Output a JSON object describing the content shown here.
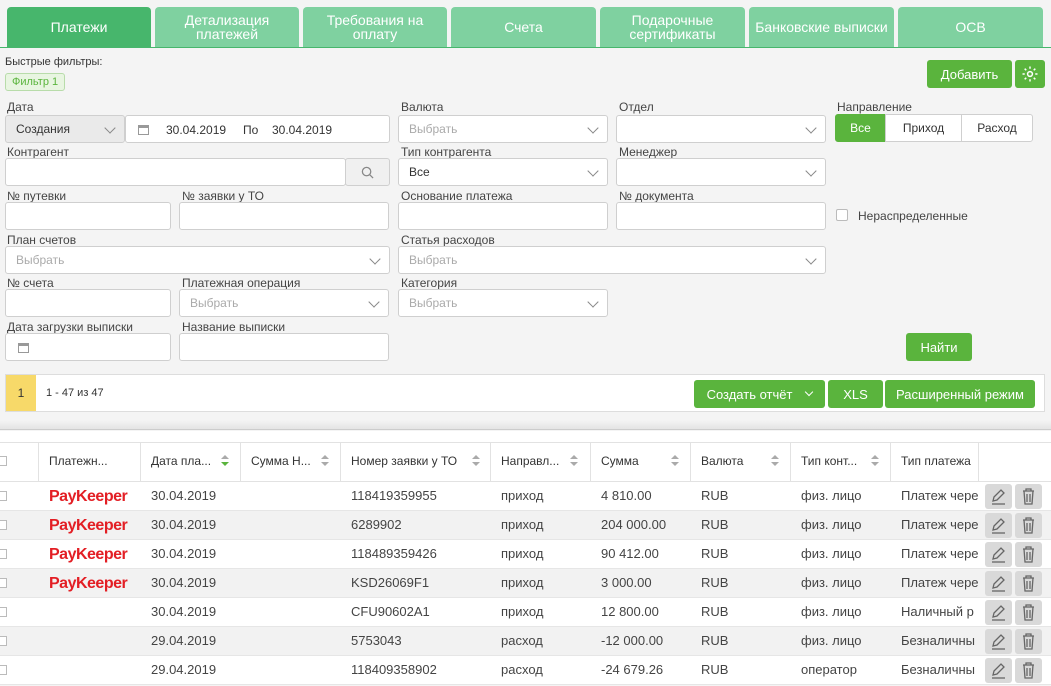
{
  "tabs": [
    {
      "label": "Платежи",
      "active": true
    },
    {
      "label": "Детализация платежей"
    },
    {
      "label": "Требования на оплату"
    },
    {
      "label": "Счета"
    },
    {
      "label": "Подарочные сертификаты"
    },
    {
      "label": "Банковские выписки"
    },
    {
      "label": "ОСВ"
    }
  ],
  "quick_filters": {
    "label": "Быстрые фильтры:",
    "chip": "Фильтр 1"
  },
  "add_button": "Добавить",
  "filters": {
    "date": {
      "label": "Дата",
      "type_value": "Создания",
      "from": "30.04.2019",
      "to_label": "По",
      "to": "30.04.2019"
    },
    "currency": {
      "label": "Валюта",
      "placeholder": "Выбрать"
    },
    "department": {
      "label": "Отдел",
      "value": ""
    },
    "direction": {
      "label": "Направление",
      "options": [
        "Все",
        "Приход",
        "Расход"
      ],
      "selected": "Все"
    },
    "counterparty": {
      "label": "Контрагент",
      "value": ""
    },
    "counterparty_type": {
      "label": "Тип контрагента",
      "value": "Все"
    },
    "manager": {
      "label": "Менеджер",
      "value": ""
    },
    "voucher_no": {
      "label": "№ путевки"
    },
    "to_request_no": {
      "label": "№ заявки у ТО"
    },
    "payment_basis": {
      "label": "Основание платежа"
    },
    "document_no": {
      "label": "№ документа"
    },
    "unallocated": {
      "label": "Нераспределенные",
      "checked": false
    },
    "chart_of_accounts": {
      "label": "План счетов",
      "placeholder": "Выбрать"
    },
    "expense_item": {
      "label": "Статья расходов",
      "placeholder": "Выбрать"
    },
    "account_no": {
      "label": "№ счета"
    },
    "payment_operation": {
      "label": "Платежная операция",
      "placeholder": "Выбрать"
    },
    "category": {
      "label": "Категория",
      "placeholder": "Выбрать"
    },
    "statement_upload_date": {
      "label": "Дата загрузки выписки"
    },
    "statement_name": {
      "label": "Название выписки"
    }
  },
  "find_button": "Найти",
  "pager": {
    "page": "1",
    "range": "1 - 47 из 47"
  },
  "toolbar": {
    "report": "Создать отчёт",
    "xls": "XLS",
    "advanced": "Расширенный режим"
  },
  "table": {
    "columns": [
      "Платежн...",
      "Дата пла...",
      "Сумма Н...",
      "Номер заявки у ТО",
      "Направл...",
      "Сумма",
      "Валюта",
      "Тип конт...",
      "Тип платежа"
    ],
    "rows": [
      {
        "system": "PayKeeper",
        "date": "30.04.2019",
        "sum_n": "",
        "request": "118419359955",
        "direction": "приход",
        "amount": "4 810.00",
        "currency": "RUB",
        "cp_type": "физ. лицо",
        "pay_type": "Платеж чере"
      },
      {
        "system": "PayKeeper",
        "date": "30.04.2019",
        "sum_n": "",
        "request": "6289902",
        "direction": "приход",
        "amount": "204 000.00",
        "currency": "RUB",
        "cp_type": "физ. лицо",
        "pay_type": "Платеж чере"
      },
      {
        "system": "PayKeeper",
        "date": "30.04.2019",
        "sum_n": "",
        "request": "118489359426",
        "direction": "приход",
        "amount": "90 412.00",
        "currency": "RUB",
        "cp_type": "физ. лицо",
        "pay_type": "Платеж чере"
      },
      {
        "system": "PayKeeper",
        "date": "30.04.2019",
        "sum_n": "",
        "request": "KSD26069F1",
        "direction": "приход",
        "amount": "3 000.00",
        "currency": "RUB",
        "cp_type": "физ. лицо",
        "pay_type": "Платеж чере"
      },
      {
        "system": "",
        "date": "30.04.2019",
        "sum_n": "",
        "request": "CFU90602A1",
        "direction": "приход",
        "amount": "12 800.00",
        "currency": "RUB",
        "cp_type": "физ. лицо",
        "pay_type": "Наличный р"
      },
      {
        "system": "",
        "date": "29.04.2019",
        "sum_n": "",
        "request": "5753043",
        "direction": "расход",
        "amount": "-12 000.00",
        "currency": "RUB",
        "cp_type": "физ. лицо",
        "pay_type": "Безналичны"
      },
      {
        "system": "",
        "date": "29.04.2019",
        "sum_n": "",
        "request": "118409358902",
        "direction": "расход",
        "amount": "-24 679.26",
        "currency": "RUB",
        "cp_type": "оператор",
        "pay_type": "Безналичны"
      }
    ]
  },
  "icons": {
    "settings": "gear-icon",
    "search": "search-icon",
    "calendar": "calendar-icon",
    "edit": "pencil-icon",
    "delete": "trash-icon"
  },
  "colors": {
    "tab_active": "#47b66c",
    "tab": "#7fd1a0",
    "button": "#5ab43d",
    "paykeeper": "#e31e24"
  }
}
